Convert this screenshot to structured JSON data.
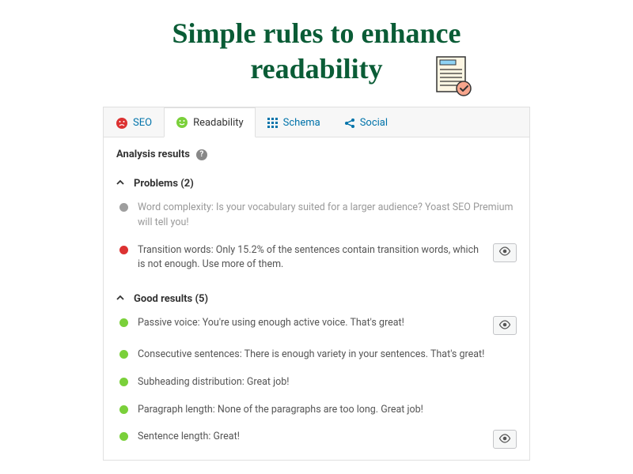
{
  "header": {
    "title": "Simple rules to enhance readability"
  },
  "tabs": [
    {
      "label": "SEO"
    },
    {
      "label": "Readability"
    },
    {
      "label": "Schema"
    },
    {
      "label": "Social"
    }
  ],
  "analysis": {
    "title": "Analysis results",
    "sections": {
      "problems": {
        "title": "Problems (2)",
        "items": [
          {
            "text": "Word complexity: Is your vocabulary suited for a larger audience? Yoast SEO Premium will tell you!"
          },
          {
            "text": "Transition words: Only 15.2% of the sentences contain transition words, which is not enough. Use more of them."
          }
        ]
      },
      "good": {
        "title": "Good results (5)",
        "items": [
          {
            "text": "Passive voice: You're using enough active voice. That's great!"
          },
          {
            "text": "Consecutive sentences: There is enough variety in your sentences. That's great!"
          },
          {
            "text": "Subheading distribution: Great job!"
          },
          {
            "text": "Paragraph length: None of the paragraphs are too long. Great job!"
          },
          {
            "text": "Sentence length: Great!"
          }
        ]
      }
    }
  }
}
